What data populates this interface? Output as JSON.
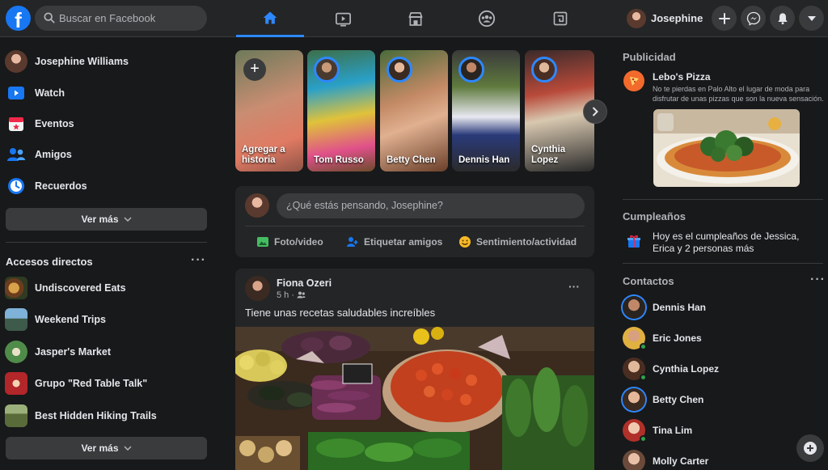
{
  "header": {
    "logo": "f",
    "search_placeholder": "Buscar en Facebook",
    "nav_tabs": [
      {
        "name": "home",
        "icon": "home-icon",
        "active": true
      },
      {
        "name": "watch",
        "icon": "video-icon",
        "active": false
      },
      {
        "name": "marketplace",
        "icon": "store-icon",
        "active": false
      },
      {
        "name": "groups",
        "icon": "groups-icon",
        "active": false
      },
      {
        "name": "gaming",
        "icon": "gaming-icon",
        "active": false
      }
    ],
    "profile_name": "Josephine",
    "actions": [
      "plus-icon",
      "messenger-icon",
      "bell-icon",
      "caret-down-icon"
    ],
    "accent": "#2d88ff"
  },
  "sidebar": {
    "items": [
      {
        "label": "Josephine Williams",
        "icon": "profile-avatar"
      },
      {
        "label": "Watch",
        "icon": "watch-icon"
      },
      {
        "label": "Eventos",
        "icon": "calendar-icon"
      },
      {
        "label": "Amigos",
        "icon": "friends-icon"
      },
      {
        "label": "Recuerdos",
        "icon": "clock-icon"
      }
    ],
    "see_more": "Ver más",
    "shortcuts_title": "Accesos directos",
    "shortcuts": [
      {
        "label": "Undiscovered Eats"
      },
      {
        "label": "Weekend Trips"
      },
      {
        "label": "Jasper's Market"
      },
      {
        "label": "Grupo \"Red Table Talk\""
      },
      {
        "label": "Best Hidden Hiking Trails"
      }
    ],
    "see_more_2": "Ver más"
  },
  "stories": [
    {
      "name": "Agregar a historia",
      "type": "add"
    },
    {
      "name": "Tom Russo"
    },
    {
      "name": "Betty Chen"
    },
    {
      "name": "Dennis Han"
    },
    {
      "name": "Cynthia Lopez"
    }
  ],
  "composer": {
    "placeholder": "¿Qué estás pensando, Josephine?",
    "actions": [
      {
        "label": "Foto/video",
        "icon": "photo-icon",
        "color": "#45bd62"
      },
      {
        "label": "Etiquetar amigos",
        "icon": "tag-friends-icon",
        "color": "#1877f2"
      },
      {
        "label": "Sentimiento/actividad",
        "icon": "emoji-icon",
        "color": "#f7b928"
      }
    ]
  },
  "post": {
    "author": "Fiona Ozeri",
    "time": "5 h ·",
    "text": "Tiene unas recetas saludables increíbles"
  },
  "right": {
    "ads_title": "Publicidad",
    "ad": {
      "name": "Lebo's Pizza",
      "description": "No te pierdas en Palo Alto el lugar de moda para disfrutar de unas pizzas que son la nueva sensación."
    },
    "birthdays_title": "Cumpleaños",
    "birthday_text": "Hoy es el cumpleaños de Jessica, Erica y 2 personas más",
    "contacts_title": "Contactos",
    "contacts": [
      {
        "name": "Dennis Han",
        "online": false,
        "ring": true
      },
      {
        "name": "Eric Jones",
        "online": true,
        "ring": false
      },
      {
        "name": "Cynthia Lopez",
        "online": true,
        "ring": false
      },
      {
        "name": "Betty Chen",
        "online": false,
        "ring": true
      },
      {
        "name": "Tina Lim",
        "online": true,
        "ring": false
      },
      {
        "name": "Molly Carter",
        "online": false,
        "ring": false
      }
    ]
  }
}
